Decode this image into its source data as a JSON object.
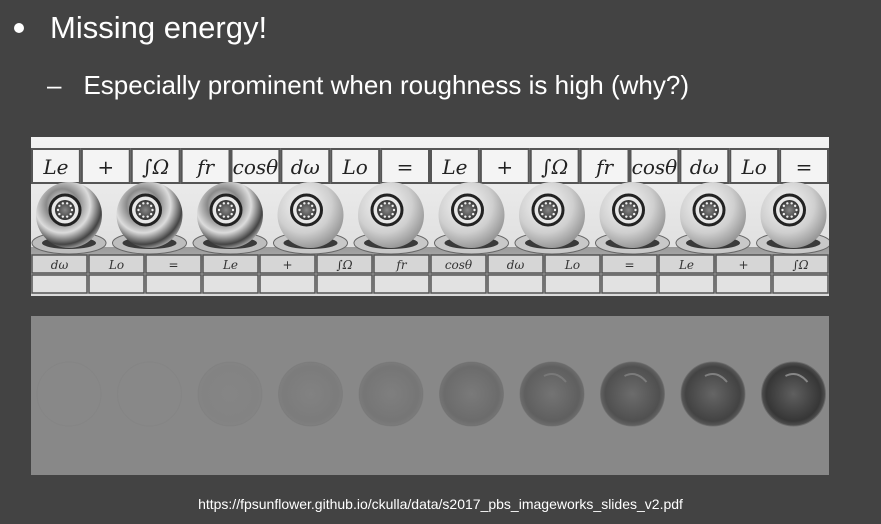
{
  "slide": {
    "bullet": "Missing energy!",
    "sub_bullet_marker": "–",
    "sub_bullet": "Especially prominent when roughness is high (why?)",
    "source_url": "https://fpsunflower.github.io/ckulla/data/s2017_pbs_imageworks_slides_v2.pdf"
  },
  "furnace_render": {
    "top_row_symbols": [
      "Le",
      "+",
      "∫Ω",
      "fr",
      "cosθ",
      "dω",
      "Lo",
      "=",
      "Le",
      "+",
      "∫Ω",
      "fr",
      "cosθ",
      "dω",
      "Lo",
      "="
    ],
    "bottom_row_symbols": [
      "dω",
      "Lo",
      "=",
      "Le",
      "+",
      "∫Ω",
      "fr",
      "cosθ",
      "dω",
      "Lo",
      "=",
      "Le",
      "+",
      "∫Ω"
    ],
    "sphere_count": 10,
    "roughness_levels": [
      0.0,
      0.1,
      0.2,
      0.3,
      0.4,
      0.5,
      0.6,
      0.7,
      0.8,
      0.9
    ],
    "energy_loss_levels": [
      0.0,
      0.0,
      0.05,
      0.12,
      0.18,
      0.28,
      0.4,
      0.55,
      0.68,
      0.8
    ]
  },
  "colors": {
    "background": "#434343",
    "text": "#ffffff"
  }
}
